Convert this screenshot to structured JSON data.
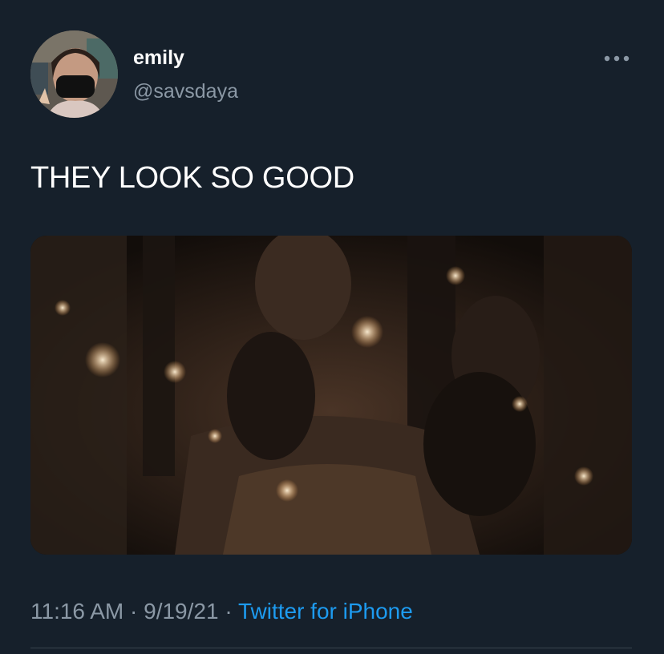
{
  "tweet": {
    "display_name": "emily",
    "handle": "@savsdaya",
    "text": "THEY LOOK SO GOOD",
    "time": "11:16 AM",
    "separator": "·",
    "date": "9/19/21",
    "source": "Twitter for iPhone"
  },
  "icons": {
    "more": "more-horizontal-icon"
  },
  "colors": {
    "background": "#16202b",
    "primary_text": "#ffffff",
    "secondary_text": "#8b98a5",
    "link": "#1d9bf0",
    "divider": "#38444d"
  }
}
